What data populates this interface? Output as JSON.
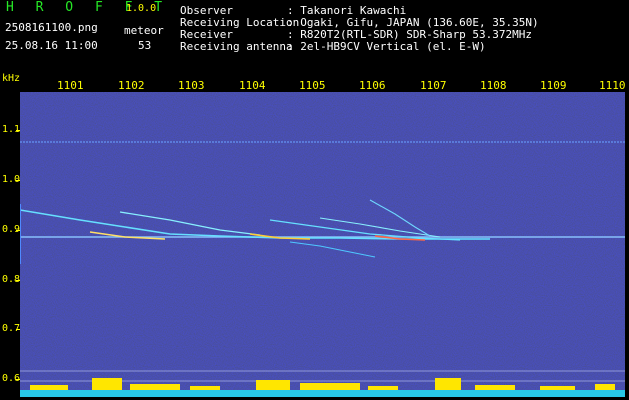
{
  "app": {
    "name": "H R O F F T",
    "version": "1.0.0"
  },
  "capture": {
    "filename": "2508161100.png",
    "datetime": "25.08.16 11:00"
  },
  "detection": {
    "label": "meteor",
    "count": "53"
  },
  "meta": [
    {
      "key": "Observer",
      "value": ": Takanori Kawachi"
    },
    {
      "key": "Receiving Location",
      "value": ": Ogaki, Gifu, JAPAN (136.60E, 35.35N)"
    },
    {
      "key": "Receiver",
      "value": ": R820T2(RTL-SDR) SDR-Sharp 53.372MHz"
    },
    {
      "key": "Receiving antenna",
      "value": ": 2el-HB9CV Vertical (el. E-W)"
    }
  ],
  "axis": {
    "y_unit": "kHz",
    "y_labels": [
      "1.1",
      "1.0",
      "0.9",
      "0.8",
      "0.7",
      "0.6"
    ],
    "x_labels": [
      "1101",
      "1102",
      "1103",
      "1104",
      "1105",
      "1106",
      "1107",
      "1108",
      "1109",
      "1110"
    ]
  },
  "colors": {
    "label": "#ffff00",
    "brand": "#26e826",
    "background": "#0a0a3c",
    "carrier": "#8cc8ff"
  }
}
